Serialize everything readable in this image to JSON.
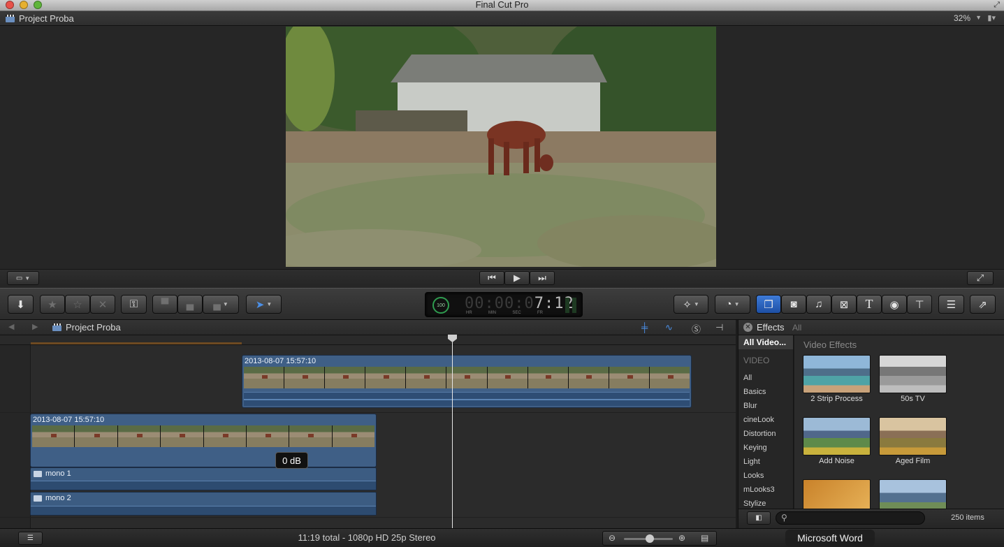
{
  "window": {
    "title": "Final Cut Pro"
  },
  "viewer": {
    "project_name": "Project Proba",
    "zoom": "32%"
  },
  "timecode": {
    "digits_dim": "00:00:0",
    "digits_bright": "7:12",
    "ring_value": "100",
    "units": [
      "HR",
      "MIN",
      "SEC",
      "FR"
    ]
  },
  "timeline": {
    "project_name": "Project Proba",
    "clips": [
      {
        "label": "2013-08-07 15:57:10"
      },
      {
        "label": "2013-08-07 15:57:10"
      }
    ],
    "audio_tracks": [
      "mono 1",
      "mono 2"
    ],
    "volume_popup": "0 dB"
  },
  "effects": {
    "title": "Effects",
    "filter": "All",
    "selected_category": "All Video...",
    "section_label": "VIDEO",
    "categories": [
      "All",
      "Basics",
      "Blur",
      "cineLook",
      "Distortion",
      "Keying",
      "Light",
      "Looks",
      "mLooks3",
      "Stylize"
    ],
    "browser_heading": "Video Effects",
    "items": [
      {
        "name": "2 Strip Process"
      },
      {
        "name": "50s TV"
      },
      {
        "name": "Add Noise"
      },
      {
        "name": "Aged Film"
      },
      {
        "name": ""
      },
      {
        "name": ""
      }
    ],
    "count": "250 items"
  },
  "status": {
    "summary": "11:19 total - 1080p HD 25p Stereo",
    "dock_tooltip": "Microsoft Word"
  }
}
